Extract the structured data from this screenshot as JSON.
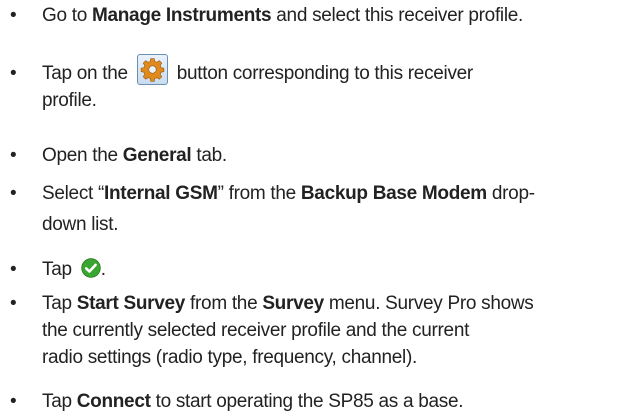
{
  "steps": [
    {
      "bullet": "•",
      "p1": "Go to ",
      "b1": "Manage Instruments",
      "p2": " and select this receiver profile."
    },
    {
      "bullet": "•",
      "p1": "Tap on the",
      "icon": "gear-icon",
      "p2": "button corresponding to this receiver",
      "line2": "profile."
    },
    {
      "bullet": "•",
      "p1": "Open the ",
      "b1": "General",
      "p2": " tab."
    },
    {
      "bullet": "•",
      "p1": "Select “",
      "b1": "Internal GSM",
      "p2": "” from the ",
      "b2": "Backup Base Modem",
      "p3": " drop-",
      "line2": "down list."
    },
    {
      "bullet": "•",
      "p1": "Tap ",
      "icon": "ok-check-icon",
      "p2": "."
    },
    {
      "bullet": "•",
      "p1": "Tap ",
      "b1": "Start Survey",
      "p2": " from the ",
      "b2": "Survey",
      "p3": " menu. Survey Pro shows",
      "line2": "the currently selected receiver profile and the current",
      "line3": "radio settings (radio type, frequency, channel)."
    },
    {
      "bullet": "•",
      "p1": "Tap ",
      "b1": "Connect",
      "p2": " to start operating the SP85 as a base."
    }
  ],
  "colors": {
    "text": "#222222",
    "gear_orange": "#e08a1e",
    "ok_green": "#3aa530"
  }
}
